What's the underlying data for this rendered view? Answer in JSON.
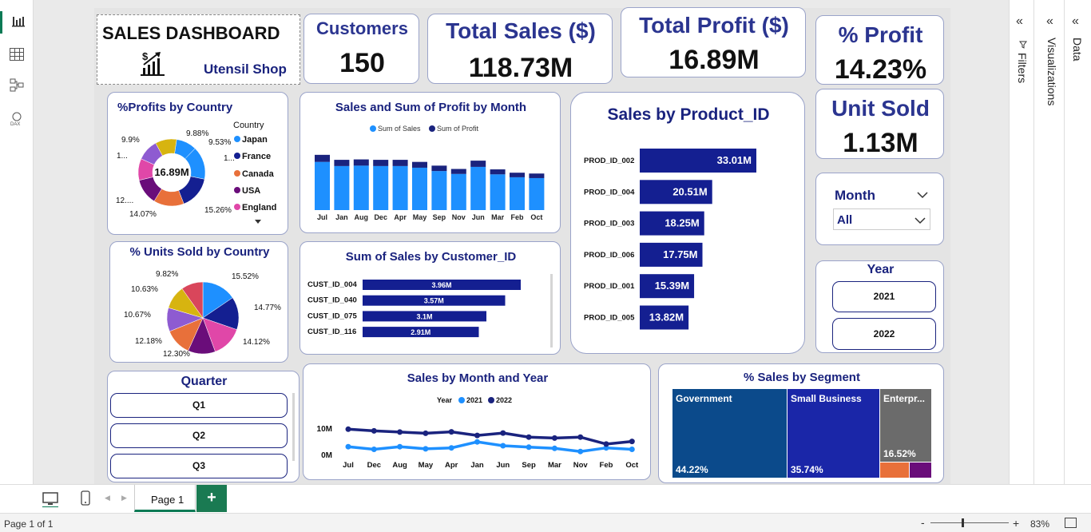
{
  "title_card": {
    "title": "SALES DASHBOARD",
    "subtitle": "Utensil Shop",
    "icon": "chart-up-icon"
  },
  "kpis": {
    "customers": {
      "label": "Customers",
      "value": "150"
    },
    "total_sales": {
      "label": "Total Sales ($)",
      "value": "118.73M"
    },
    "total_profit": {
      "label": "Total Profit ($)",
      "value": "16.89M"
    },
    "pct_profit": {
      "label": "% Profit",
      "value": "14.23%"
    },
    "unit_sold": {
      "label": "Unit Sold",
      "value": "1.13M"
    }
  },
  "profits_by_country": {
    "title": "%Profits by Country",
    "center": "16.89M",
    "legend_title": "Country",
    "legend": [
      "Japan",
      "France",
      "Canada",
      "USA",
      "England"
    ],
    "labels": [
      "9.88%",
      "9.53%",
      "1...",
      "15.26%",
      "14.07%",
      "12....",
      "1...",
      "9.9%"
    ]
  },
  "sales_profit_month": {
    "title": "Sales and Sum of Profit by Month",
    "legend": [
      "Sum of Sales",
      "Sum of Profit"
    ],
    "months": [
      "Jul",
      "Jan",
      "Aug",
      "Dec",
      "Apr",
      "May",
      "Sep",
      "Nov",
      "Jun",
      "Mar",
      "Feb",
      "Oct"
    ]
  },
  "product_sales": {
    "title": "Sales by Product_ID",
    "rows": [
      {
        "id": "PROD_ID_002",
        "value": "33.01M"
      },
      {
        "id": "PROD_ID_004",
        "value": "20.51M"
      },
      {
        "id": "PROD_ID_003",
        "value": "18.25M"
      },
      {
        "id": "PROD_ID_006",
        "value": "17.75M"
      },
      {
        "id": "PROD_ID_001",
        "value": "15.39M"
      },
      {
        "id": "PROD_ID_005",
        "value": "13.82M"
      }
    ]
  },
  "units_by_country": {
    "title": "% Units Sold by Country",
    "labels": [
      "15.52%",
      "14.77%",
      "14.12%",
      "12.30%",
      "12.18%",
      "10.67%",
      "10.63%",
      "9.82%"
    ]
  },
  "customer_sales": {
    "title": "Sum of Sales by Customer_ID",
    "rows": [
      {
        "id": "CUST_ID_004",
        "value": "3.96M"
      },
      {
        "id": "CUST_ID_040",
        "value": "3.57M"
      },
      {
        "id": "CUST_ID_075",
        "value": "3.1M"
      },
      {
        "id": "CUST_ID_116",
        "value": "2.91M"
      }
    ]
  },
  "month_slicer": {
    "label": "Month",
    "value": "All"
  },
  "year_slicer": {
    "label": "Year",
    "options": [
      "2021",
      "2022"
    ]
  },
  "quarter_slicer": {
    "label": "Quarter",
    "options": [
      "Q1",
      "Q2",
      "Q3"
    ]
  },
  "month_year": {
    "title": "Sales by Month and Year",
    "legend_title": "Year",
    "legend": [
      "2021",
      "2022"
    ],
    "yticks": [
      "10M",
      "0M"
    ],
    "months": [
      "Jul",
      "Dec",
      "Aug",
      "May",
      "Apr",
      "Jan",
      "Jun",
      "Sep",
      "Mar",
      "Nov",
      "Feb",
      "Oct"
    ]
  },
  "segment": {
    "title": "% Sales by Segment",
    "tiles": [
      {
        "name": "Government",
        "pct": "44.22%"
      },
      {
        "name": "Small Business",
        "pct": "35.74%"
      },
      {
        "name": "Enterpr...",
        "pct": "16.52%"
      }
    ]
  },
  "side_panes": {
    "filters": "Filters",
    "visualizations": "Visualizations",
    "data": "Data"
  },
  "bottom": {
    "page_tab": "Page 1",
    "add_page": "+",
    "status": "Page 1 of 1",
    "zoom": "83%"
  },
  "chart_data": [
    {
      "type": "bar",
      "title": "Sales and Sum of Profit by Month",
      "categories": [
        "Jul",
        "Jan",
        "Aug",
        "Dec",
        "Apr",
        "May",
        "Sep",
        "Nov",
        "Jun",
        "Mar",
        "Feb",
        "Oct"
      ],
      "series": [
        {
          "name": "Sum of Sales",
          "values": [
            11.6,
            10.6,
            10.7,
            10.6,
            10.6,
            10.2,
            9.4,
            8.7,
            10.4,
            8.6,
            7.9,
            7.7
          ]
        },
        {
          "name": "Sum of Profit",
          "values": [
            1.7,
            1.5,
            1.5,
            1.5,
            1.5,
            1.4,
            1.3,
            1.2,
            1.5,
            1.2,
            1.1,
            1.1
          ]
        }
      ],
      "stacked": true
    },
    {
      "type": "bar",
      "title": "Sales by Product_ID",
      "orientation": "horizontal",
      "categories": [
        "PROD_ID_002",
        "PROD_ID_004",
        "PROD_ID_003",
        "PROD_ID_006",
        "PROD_ID_001",
        "PROD_ID_005"
      ],
      "values": [
        33.01,
        20.51,
        18.25,
        17.75,
        15.39,
        13.82
      ]
    },
    {
      "type": "bar",
      "title": "Sum of Sales by Customer_ID",
      "orientation": "horizontal",
      "categories": [
        "CUST_ID_004",
        "CUST_ID_040",
        "CUST_ID_075",
        "CUST_ID_116"
      ],
      "values": [
        3.96,
        3.57,
        3.1,
        2.91
      ]
    },
    {
      "type": "line",
      "title": "Sales by Month and Year",
      "categories": [
        "Jul",
        "Dec",
        "Aug",
        "May",
        "Apr",
        "Jan",
        "Jun",
        "Sep",
        "Mar",
        "Nov",
        "Feb",
        "Oct"
      ],
      "ylim": [
        0,
        12
      ],
      "series": [
        {
          "name": "2021",
          "values": [
            3.6,
            2.5,
            3.6,
            2.7,
            3.1,
            5.6,
            4.0,
            3.4,
            2.9,
            1.6,
            3.1,
            2.5
          ]
        },
        {
          "name": "2022",
          "values": [
            10.9,
            10.2,
            9.7,
            9.2,
            9.8,
            8.3,
            9.3,
            7.6,
            7.2,
            7.6,
            4.7,
            5.8
          ]
        }
      ]
    },
    {
      "type": "pie",
      "title": "% Units Sold by Country",
      "values": [
        15.52,
        14.77,
        14.12,
        12.3,
        12.18,
        10.67,
        10.63,
        9.82
      ]
    },
    {
      "type": "pie",
      "title": "%Profits by Country",
      "donut": true,
      "values": [
        9.88,
        9.53,
        15.26,
        15.26,
        14.07,
        12.0,
        10.0,
        9.9
      ]
    }
  ],
  "colors": {
    "navy": "#1a237e",
    "bar_dark": "#141f91",
    "sales": "#1e90ff",
    "profit": "#1a237e",
    "gov": "#0b4a8b",
    "small": "#1a26a8",
    "ent": "#6b6b6b",
    "pie": [
      "#1e90ff",
      "#141f91",
      "#e047a8",
      "#6a0d7a",
      "#e8703a",
      "#8e5bd1",
      "#d7b410",
      "#d9465b"
    ]
  }
}
